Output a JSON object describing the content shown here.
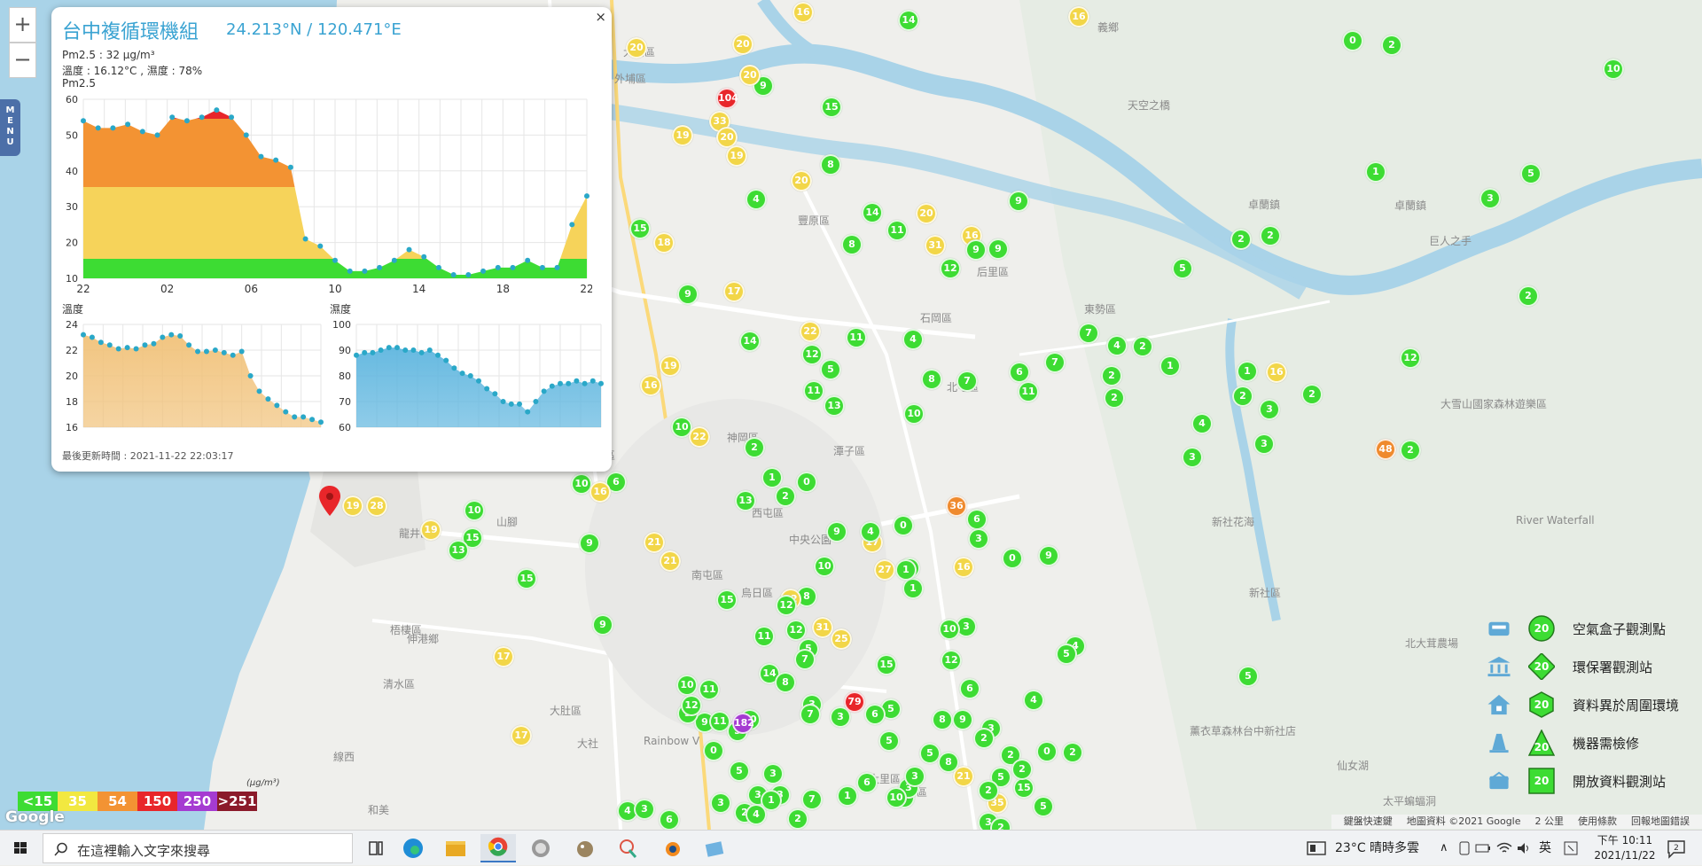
{
  "map": {
    "zoom_in": "+",
    "zoom_out": "−",
    "menu_label": "MENU",
    "place_labels": [
      "大甲區",
      "大安區",
      "外埔區",
      "后里區",
      "新社區",
      "卓蘭鎮",
      "石岡區",
      "東勢區",
      "太平區",
      "大里區",
      "烏日區",
      "大肚區",
      "龍井區",
      "梧棲區",
      "清水區",
      "沙鹿區",
      "神岡區",
      "豐原區",
      "潭子區",
      "北屯區",
      "西屯區",
      "南屯區",
      "中央公園",
      "Rainbow V",
      "仙女湖",
      "太平蝙蝠洞",
      "新社花海",
      "天空之橋",
      "卓蘭鎮",
      "巨人之手",
      "大雪山國家森林遊樂區",
      "River Waterfall",
      "北大茸農場",
      "薰衣草森林台中新社店",
      "大社",
      "伸港鄉",
      "山腳",
      "線西",
      "和美",
      "義鄉"
    ],
    "markers_note": "",
    "markers": [
      {
        "v": "16",
        "c": "#f2d648"
      },
      {
        "v": "14",
        "c": "#3ddc33"
      },
      {
        "v": "16",
        "c": "#f2d648"
      },
      {
        "v": "0",
        "c": "#3ddc33"
      },
      {
        "v": "2",
        "c": "#3ddc33"
      },
      {
        "v": "10",
        "c": "#3ddc33"
      },
      {
        "v": "20",
        "c": "#f2d648"
      },
      {
        "v": "20",
        "c": "#f2d648"
      },
      {
        "v": "104",
        "c": "#e8262a"
      },
      {
        "v": "9",
        "c": "#3ddc33"
      },
      {
        "v": "20",
        "c": "#f2d648"
      },
      {
        "v": "33",
        "c": "#f2d648"
      },
      {
        "v": "19",
        "c": "#f2d648"
      },
      {
        "v": "20",
        "c": "#f2d648"
      },
      {
        "v": "19",
        "c": "#f2d648"
      },
      {
        "v": "15",
        "c": "#3ddc33"
      },
      {
        "v": "8",
        "c": "#3ddc33"
      },
      {
        "v": "20",
        "c": "#f2d648"
      },
      {
        "v": "4",
        "c": "#3ddc33"
      },
      {
        "v": "9",
        "c": "#3ddc33"
      },
      {
        "v": "1",
        "c": "#3ddc33"
      },
      {
        "v": "3",
        "c": "#3ddc33"
      },
      {
        "v": "5",
        "c": "#3ddc33"
      },
      {
        "v": "14",
        "c": "#3ddc33"
      },
      {
        "v": "11",
        "c": "#3ddc33"
      },
      {
        "v": "20",
        "c": "#f2d648"
      },
      {
        "v": "31",
        "c": "#f2d648"
      },
      {
        "v": "16",
        "c": "#f2d648"
      },
      {
        "v": "9",
        "c": "#3ddc33"
      },
      {
        "v": "9",
        "c": "#3ddc33"
      },
      {
        "v": "12",
        "c": "#3ddc33"
      },
      {
        "v": "8",
        "c": "#3ddc33"
      },
      {
        "v": "15",
        "c": "#3ddc33"
      },
      {
        "v": "18",
        "c": "#f2d648"
      },
      {
        "v": "2",
        "c": "#3ddc33"
      },
      {
        "v": "2",
        "c": "#3ddc33"
      },
      {
        "v": "5",
        "c": "#3ddc33"
      },
      {
        "v": "9",
        "c": "#3ddc33"
      },
      {
        "v": "17",
        "c": "#f2d648"
      },
      {
        "v": "2",
        "c": "#3ddc33"
      },
      {
        "v": "22",
        "c": "#f2d648"
      },
      {
        "v": "14",
        "c": "#3ddc33"
      },
      {
        "v": "11",
        "c": "#3ddc33"
      },
      {
        "v": "4",
        "c": "#3ddc33"
      },
      {
        "v": "7",
        "c": "#3ddc33"
      },
      {
        "v": "4",
        "c": "#3ddc33"
      },
      {
        "v": "2",
        "c": "#3ddc33"
      },
      {
        "v": "1",
        "c": "#3ddc33"
      },
      {
        "v": "2",
        "c": "#3ddc33"
      },
      {
        "v": "2",
        "c": "#3ddc33"
      },
      {
        "v": "19",
        "c": "#f2d648"
      },
      {
        "v": "16",
        "c": "#f2d648"
      },
      {
        "v": "12",
        "c": "#3ddc33"
      },
      {
        "v": "5",
        "c": "#3ddc33"
      },
      {
        "v": "11",
        "c": "#3ddc33"
      },
      {
        "v": "13",
        "c": "#3ddc33"
      },
      {
        "v": "10",
        "c": "#3ddc33"
      },
      {
        "v": "8",
        "c": "#3ddc33"
      },
      {
        "v": "7",
        "c": "#3ddc33"
      },
      {
        "v": "6",
        "c": "#3ddc33"
      },
      {
        "v": "11",
        "c": "#3ddc33"
      },
      {
        "v": "7",
        "c": "#3ddc33"
      },
      {
        "v": "2",
        "c": "#3ddc33"
      },
      {
        "v": "1",
        "c": "#3ddc33"
      },
      {
        "v": "3",
        "c": "#3ddc33"
      },
      {
        "v": "2",
        "c": "#3ddc33"
      },
      {
        "v": "12",
        "c": "#3ddc33"
      },
      {
        "v": "16",
        "c": "#f2d648"
      },
      {
        "v": "2",
        "c": "#3ddc33"
      },
      {
        "v": "10",
        "c": "#3ddc33"
      },
      {
        "v": "22",
        "c": "#f2d648"
      },
      {
        "v": "2",
        "c": "#3ddc33"
      },
      {
        "v": "4",
        "c": "#3ddc33"
      },
      {
        "v": "3",
        "c": "#3ddc33"
      },
      {
        "v": "3",
        "c": "#3ddc33"
      },
      {
        "v": "48",
        "c": "#ef8a2e"
      },
      {
        "v": "6",
        "c": "#3ddc33"
      },
      {
        "v": "10",
        "c": "#3ddc33"
      },
      {
        "v": "16",
        "c": "#f2d648"
      },
      {
        "v": "19",
        "c": "#f2d648"
      },
      {
        "v": "28",
        "c": "#f2d648"
      },
      {
        "v": "10",
        "c": "#3ddc33"
      },
      {
        "v": "19",
        "c": "#f2d648"
      },
      {
        "v": "15",
        "c": "#3ddc33"
      },
      {
        "v": "13",
        "c": "#3ddc33"
      },
      {
        "v": "9",
        "c": "#3ddc33"
      },
      {
        "v": "21",
        "c": "#f2d648"
      },
      {
        "v": "21",
        "c": "#f2d648"
      },
      {
        "v": "15",
        "c": "#3ddc33"
      },
      {
        "v": "1",
        "c": "#3ddc33"
      },
      {
        "v": "0",
        "c": "#3ddc33"
      },
      {
        "v": "13",
        "c": "#3ddc33"
      },
      {
        "v": "2",
        "c": "#3ddc33"
      },
      {
        "v": "9",
        "c": "#3ddc33"
      },
      {
        "v": "17",
        "c": "#f2d648"
      },
      {
        "v": "0",
        "c": "#3ddc33"
      },
      {
        "v": "36",
        "c": "#ef8a2e"
      },
      {
        "v": "6",
        "c": "#3ddc33"
      },
      {
        "v": "3",
        "c": "#3ddc33"
      },
      {
        "v": "1",
        "c": "#3ddc33"
      },
      {
        "v": "4",
        "c": "#3ddc33"
      },
      {
        "v": "9",
        "c": "#3ddc33"
      },
      {
        "v": "27",
        "c": "#f2d648"
      },
      {
        "v": "1",
        "c": "#3ddc33"
      },
      {
        "v": "10",
        "c": "#3ddc33"
      },
      {
        "v": "8",
        "c": "#3ddc33"
      },
      {
        "v": "22",
        "c": "#f2d648"
      },
      {
        "v": "12",
        "c": "#3ddc33"
      },
      {
        "v": "15",
        "c": "#3ddc33"
      },
      {
        "v": "12",
        "c": "#3ddc33"
      },
      {
        "v": "11",
        "c": "#3ddc33"
      },
      {
        "v": "10",
        "c": "#3ddc33"
      },
      {
        "v": "9",
        "c": "#3ddc33"
      },
      {
        "v": "14",
        "c": "#3ddc33"
      },
      {
        "v": "16",
        "c": "#f2d648"
      },
      {
        "v": "0",
        "c": "#3ddc33"
      },
      {
        "v": "25",
        "c": "#f2d648"
      },
      {
        "v": "5",
        "c": "#3ddc33"
      },
      {
        "v": "7",
        "c": "#3ddc33"
      },
      {
        "v": "31",
        "c": "#f2d648"
      },
      {
        "v": "3",
        "c": "#3ddc33"
      },
      {
        "v": "17",
        "c": "#f2d648"
      },
      {
        "v": "11",
        "c": "#3ddc33"
      },
      {
        "v": "10",
        "c": "#3ddc33"
      },
      {
        "v": "11",
        "c": "#3ddc33"
      },
      {
        "v": "17",
        "c": "#f2d648"
      },
      {
        "v": "9",
        "c": "#3ddc33"
      },
      {
        "v": "3",
        "c": "#3ddc33"
      },
      {
        "v": "0",
        "c": "#3ddc33"
      },
      {
        "v": "5",
        "c": "#3ddc33"
      },
      {
        "v": "182",
        "c": "#a53bd1"
      },
      {
        "v": "12",
        "c": "#3ddc33"
      },
      {
        "v": "5",
        "c": "#3ddc33"
      },
      {
        "v": "3",
        "c": "#3ddc33"
      },
      {
        "v": "7",
        "c": "#3ddc33"
      },
      {
        "v": "6",
        "c": "#3ddc33"
      },
      {
        "v": "21",
        "c": "#f2d648"
      },
      {
        "v": "5",
        "c": "#3ddc33"
      },
      {
        "v": "2",
        "c": "#3ddc33"
      },
      {
        "v": "4",
        "c": "#3ddc33"
      },
      {
        "v": "3",
        "c": "#3ddc33"
      },
      {
        "v": "0",
        "c": "#3ddc33"
      },
      {
        "v": "2",
        "c": "#3ddc33"
      },
      {
        "v": "35",
        "c": "#f2d648"
      },
      {
        "v": "3",
        "c": "#3ddc33"
      },
      {
        "v": "2",
        "c": "#3ddc33"
      },
      {
        "v": "4",
        "c": "#3ddc33"
      },
      {
        "v": "9",
        "c": "#3ddc33"
      },
      {
        "v": "5",
        "c": "#3ddc33"
      },
      {
        "v": "5",
        "c": "#3ddc33"
      },
      {
        "v": "3",
        "c": "#3ddc33"
      },
      {
        "v": "10",
        "c": "#3ddc33"
      },
      {
        "v": "15",
        "c": "#3ddc33"
      },
      {
        "v": "12",
        "c": "#3ddc33"
      },
      {
        "v": "6",
        "c": "#3ddc33"
      },
      {
        "v": "5",
        "c": "#3ddc33"
      },
      {
        "v": "3",
        "c": "#3ddc33"
      },
      {
        "v": "6",
        "c": "#3ddc33"
      },
      {
        "v": "79",
        "c": "#e8262a"
      },
      {
        "v": "7",
        "c": "#3ddc33"
      },
      {
        "v": "8",
        "c": "#3ddc33"
      },
      {
        "v": "9",
        "c": "#3ddc33"
      },
      {
        "v": "5",
        "c": "#3ddc33"
      },
      {
        "v": "4",
        "c": "#3ddc33"
      },
      {
        "v": "3",
        "c": "#3ddc33"
      },
      {
        "v": "6",
        "c": "#3ddc33"
      },
      {
        "v": "3",
        "c": "#3ddc33"
      },
      {
        "v": "2",
        "c": "#3ddc33"
      },
      {
        "v": "3",
        "c": "#3ddc33"
      },
      {
        "v": "1",
        "c": "#3ddc33"
      },
      {
        "v": "2",
        "c": "#3ddc33"
      },
      {
        "v": "1",
        "c": "#3ddc33"
      },
      {
        "v": "3",
        "c": "#3ddc33"
      },
      {
        "v": "5",
        "c": "#3ddc33"
      },
      {
        "v": "15",
        "c": "#3ddc33"
      },
      {
        "v": "5",
        "c": "#3ddc33"
      },
      {
        "v": "3",
        "c": "#3ddc33"
      },
      {
        "v": "2",
        "c": "#3ddc33"
      },
      {
        "v": "2",
        "c": "#3ddc33"
      },
      {
        "v": "5",
        "c": "#3ddc33"
      },
      {
        "v": "10",
        "c": "#3ddc33"
      },
      {
        "v": "3",
        "c": "#3ddc33"
      },
      {
        "v": "4",
        "c": "#3ddc33"
      },
      {
        "v": "2",
        "c": "#3ddc33"
      },
      {
        "v": "8",
        "c": "#3ddc33"
      },
      {
        "v": "8",
        "c": "#3ddc33"
      }
    ]
  },
  "popup": {
    "close": "×",
    "title": "台中複循環機組",
    "coords": "24.213°N / 120.471°E",
    "pm25_line": "Pm2.5 : 32 μg/m³",
    "temp_humidity_line": "溫度 : 16.12°C , 濕度 : 78%",
    "pm_chart_label": "Pm2.5",
    "temp_chart_label": "溫度",
    "humidity_chart_label": "濕度",
    "updated": "最後更新時間 : 2021-11-22 22:03:17"
  },
  "chart_data": [
    {
      "type": "area",
      "title": "Pm2.5",
      "x_tick_labels": [
        "22",
        "02",
        "06",
        "10",
        "14",
        "18",
        "22"
      ],
      "ylim": [
        10,
        60
      ],
      "y_ticks": [
        10,
        20,
        30,
        40,
        50,
        60
      ],
      "grid": true,
      "values": [
        54,
        52,
        52,
        53,
        51,
        50,
        55,
        54,
        55,
        57,
        55,
        50,
        44,
        43,
        41,
        21,
        19,
        15,
        12,
        12,
        13,
        15,
        18,
        16,
        13,
        11,
        11,
        12,
        13,
        13,
        15,
        13,
        13,
        25,
        33
      ],
      "color_bands": [
        {
          "max": 15.5,
          "color": "#3ddc33"
        },
        {
          "max": 35.5,
          "color": "#f6d35a"
        },
        {
          "max": 54.5,
          "color": "#f39333"
        },
        {
          "max": 150,
          "color": "#e8262a"
        }
      ]
    },
    {
      "type": "area",
      "title": "溫度",
      "ylim": [
        16,
        24
      ],
      "y_ticks": [
        16,
        18,
        20,
        22,
        24
      ],
      "grid": true,
      "values": [
        23.2,
        23,
        22.6,
        22.4,
        22.1,
        22.2,
        22.1,
        22.4,
        22.5,
        23,
        23.2,
        23.1,
        22.4,
        21.9,
        21.9,
        22,
        21.8,
        21.6,
        21.9,
        20,
        18.8,
        18.2,
        17.7,
        17.2,
        16.8,
        16.8,
        16.6,
        16.4
      ],
      "color": "#f1c27a"
    },
    {
      "type": "area",
      "title": "濕度",
      "ylim": [
        60,
        100
      ],
      "y_ticks": [
        60,
        70,
        80,
        90,
        100
      ],
      "grid": true,
      "values": [
        88,
        89,
        89,
        90,
        91,
        91,
        90,
        90,
        89,
        90,
        88,
        86,
        83,
        81,
        80,
        78,
        75,
        73,
        70,
        69,
        69,
        66,
        70,
        74,
        76,
        77,
        77,
        78,
        77,
        78,
        77
      ],
      "color": "#5fb6df"
    }
  ],
  "legend_right": [
    {
      "text": "空氣盒子觀測點",
      "badge": "20",
      "icon": "airbox-icon",
      "shape": "circle"
    },
    {
      "text": "環保署觀測站",
      "badge": "20",
      "icon": "government-building-icon",
      "shape": "diamond"
    },
    {
      "text": "資料異於周圍環境",
      "badge": "20",
      "icon": "house-icon",
      "shape": "hexagon"
    },
    {
      "text": "機器需檢修",
      "badge": "20",
      "icon": "cone-icon",
      "shape": "triangle"
    },
    {
      "text": "開放資料觀測站",
      "badge": "20",
      "icon": "open-data-icon",
      "shape": "square"
    }
  ],
  "aqi_legend": {
    "unit": "(μg/m³)",
    "cells": [
      {
        "label": "<15",
        "color": "#3ddc33"
      },
      {
        "label": "35",
        "color": "#f2e840"
      },
      {
        "label": "54",
        "color": "#f39333"
      },
      {
        "label": "150",
        "color": "#e8262a"
      },
      {
        "label": "250",
        "color": "#a53bd1"
      },
      {
        "label": ">251",
        "color": "#8b1a2a"
      }
    ]
  },
  "google_logo": "Google",
  "map_footer": [
    "鍵盤快速鍵",
    "地圖資料 ©2021 Google",
    "2 公里",
    "使用條款",
    "回報地圖錯誤"
  ],
  "taskbar": {
    "search_placeholder": "在這裡輸入文字來搜尋",
    "weather": "23°C  晴時多雲",
    "ime": "英",
    "time": "下午 10:11",
    "date": "2021/11/22",
    "notification_count": "2"
  }
}
